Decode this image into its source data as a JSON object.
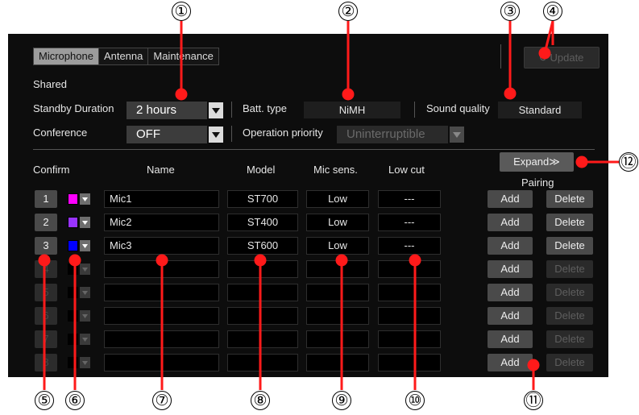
{
  "tabs": [
    "Microphone",
    "Antenna",
    "Maintenance"
  ],
  "active_tab": "Microphone",
  "update_label": "Update",
  "shared_label": "Shared",
  "standby": {
    "label": "Standby Duration",
    "value": "2 hours"
  },
  "batt": {
    "label": "Batt. type",
    "value": "NiMH"
  },
  "sound": {
    "label": "Sound quality",
    "value": "Standard"
  },
  "conference": {
    "label": "Conference",
    "value": "OFF"
  },
  "priority": {
    "label": "Operation priority",
    "value": "Uninterruptible"
  },
  "headers": {
    "confirm": "Confirm",
    "name": "Name",
    "model": "Model",
    "sens": "Mic sens.",
    "lowcut": "Low cut",
    "pairing": "Pairing"
  },
  "expand_label": "Expand≫",
  "add_label": "Add",
  "delete_label": "Delete",
  "rows": [
    {
      "num": "1",
      "color": "#ff00ff",
      "name": "Mic1",
      "model": "ST700",
      "sens": "Low",
      "lowcut": "---"
    },
    {
      "num": "2",
      "color": "#9933ff",
      "name": "Mic2",
      "model": "ST400",
      "sens": "Low",
      "lowcut": "---"
    },
    {
      "num": "3",
      "color": "#0000ff",
      "name": "Mic3",
      "model": "ST600",
      "sens": "Low",
      "lowcut": "---"
    },
    {
      "num": "4",
      "color": "",
      "name": "",
      "model": "",
      "sens": "",
      "lowcut": ""
    },
    {
      "num": "5",
      "color": "",
      "name": "",
      "model": "",
      "sens": "",
      "lowcut": ""
    },
    {
      "num": "6",
      "color": "",
      "name": "",
      "model": "",
      "sens": "",
      "lowcut": ""
    },
    {
      "num": "7",
      "color": "",
      "name": "",
      "model": "",
      "sens": "",
      "lowcut": ""
    },
    {
      "num": "8",
      "color": "",
      "name": "",
      "model": "",
      "sens": "",
      "lowcut": ""
    }
  ],
  "callouts": [
    "①",
    "②",
    "③",
    "④",
    "⑤",
    "⑥",
    "⑦",
    "⑧",
    "⑨",
    "⑩",
    "⑪",
    "⑫"
  ]
}
